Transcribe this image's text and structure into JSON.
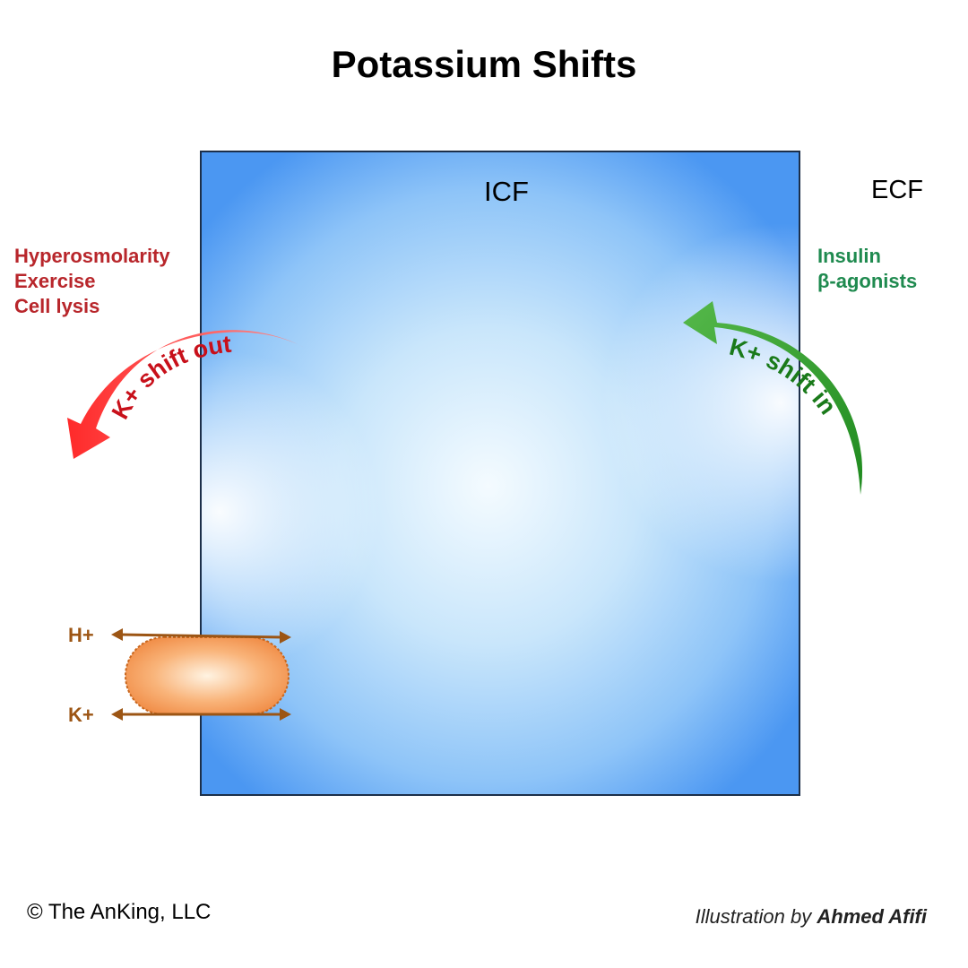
{
  "title": "Potassium Shifts",
  "compartments": {
    "intracellular": "ICF",
    "extracellular": "ECF"
  },
  "shift_out": {
    "label": "K+ shift out",
    "causes": [
      "Hyperosmolarity",
      "Exercise",
      "Cell lysis"
    ],
    "color": "#e8232b"
  },
  "shift_in": {
    "label": "K+ shift in",
    "causes": [
      "Insulin",
      "β-agonists"
    ],
    "color": "#1f8a3a"
  },
  "exchanger": {
    "ions": [
      "H+",
      "K+"
    ],
    "color": "#f5a46b",
    "arrow_color": "#9c5514"
  },
  "footer": {
    "copyright": "© The AnKing, LLC",
    "credit_prefix": "Illustration by",
    "credit_name": "Ahmed Afifi"
  },
  "colors": {
    "cell_edge": "#4b97f2",
    "cell_center": "#f4fbff"
  }
}
